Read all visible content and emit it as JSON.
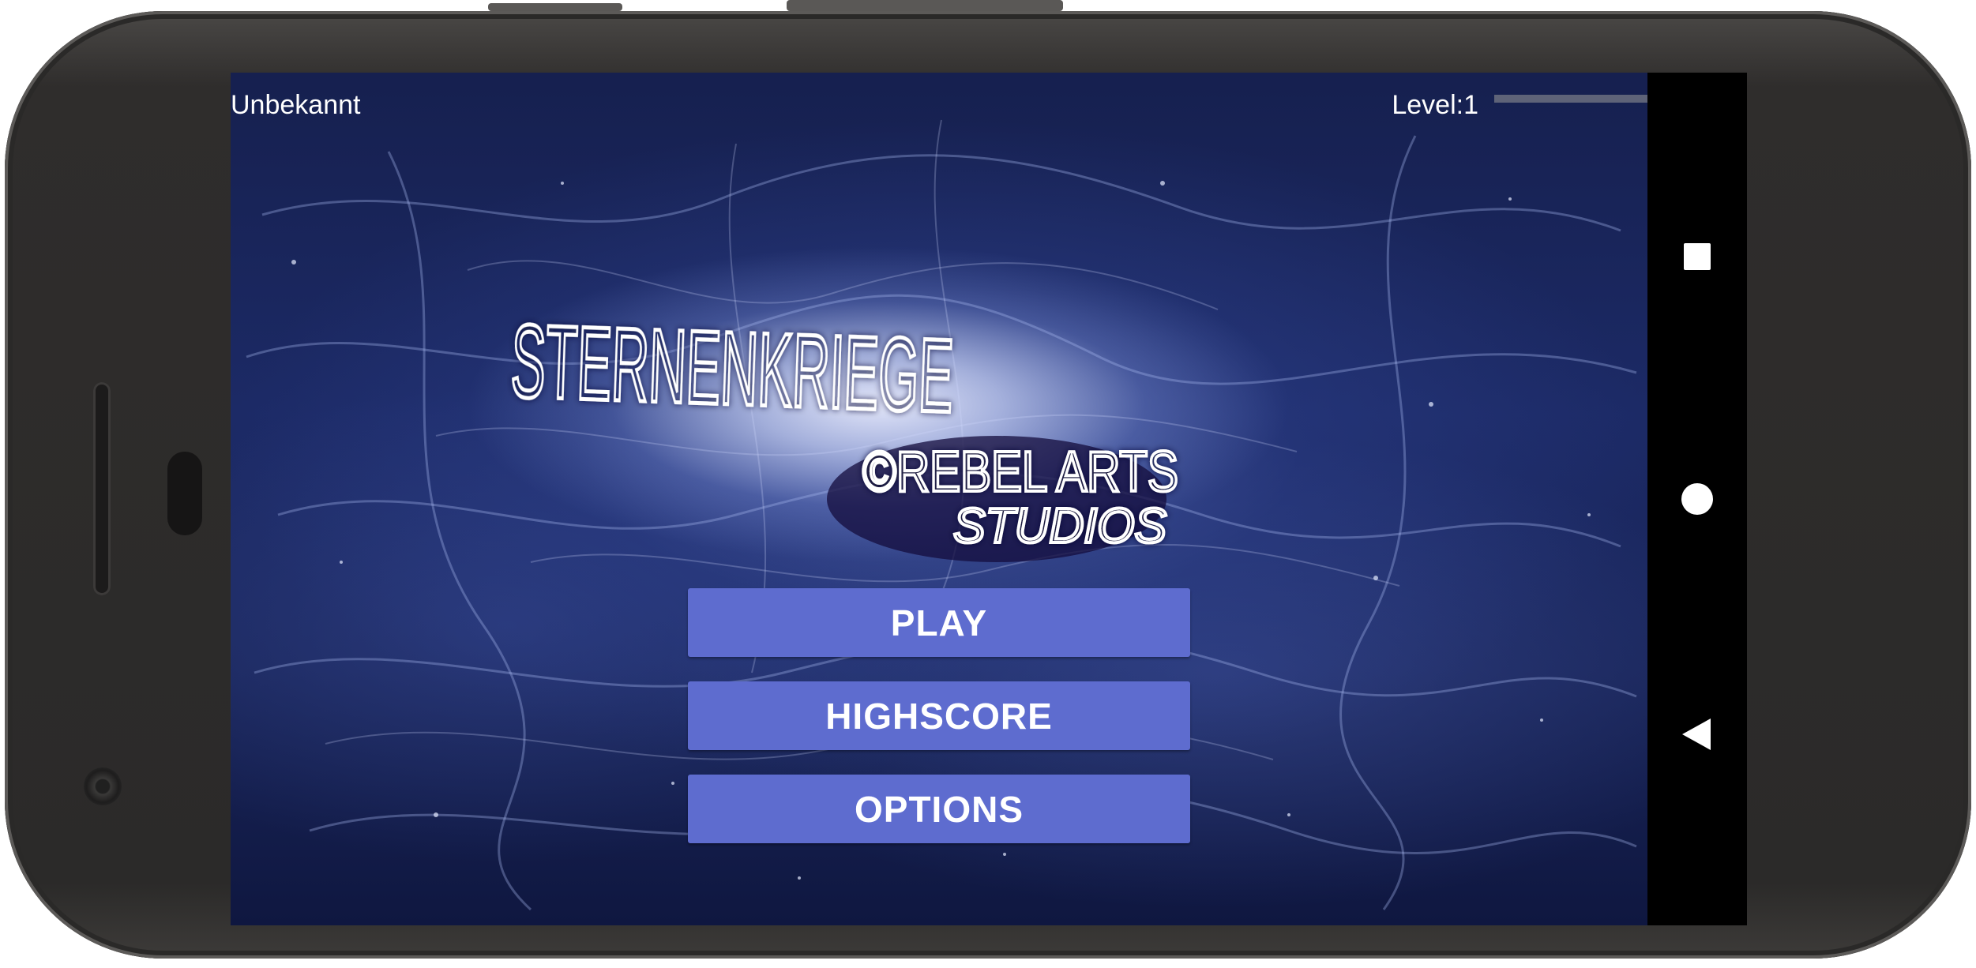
{
  "status": {
    "player_name": "Unbekannt",
    "level_label": "Level:1",
    "level_progress": 0.0
  },
  "logo": {
    "title": "STERNENKRIEGE",
    "studio_line1": "©REBEL ARTS",
    "studio_line2": "STUDIOS"
  },
  "menu": {
    "play_label": "PLAY",
    "highscore_label": "HIGHSCORE",
    "options_label": "OPTIONS"
  },
  "navbar": {
    "recents_icon": "square-icon",
    "home_icon": "circle-icon",
    "back_icon": "triangle-back-icon"
  },
  "colors": {
    "button": "#5e6ccf",
    "background": "#1c2a66"
  }
}
